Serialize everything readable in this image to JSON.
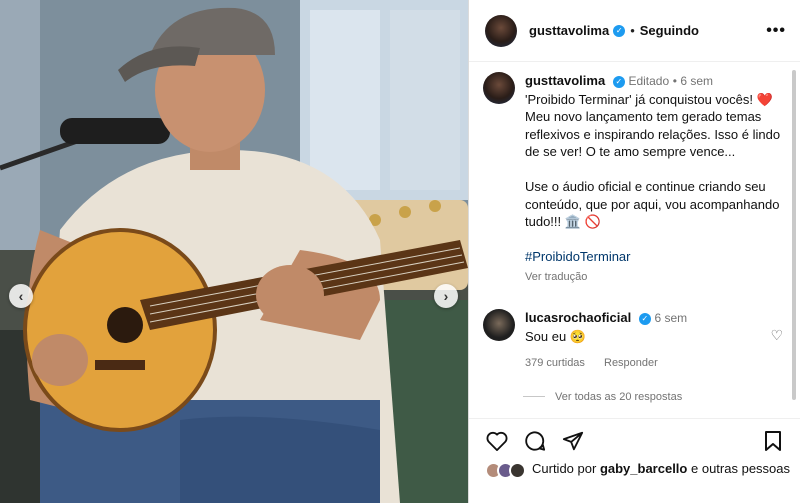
{
  "post": {
    "username": "gusttavolima",
    "follow_status": "Seguindo",
    "more_label": "•••"
  },
  "caption": {
    "username": "gusttavolima",
    "edited": "Editado",
    "time": "6 sem",
    "para1": "'Proibido Terminar' já conquistou vocês! ❤️ Meu novo lançamento tem gerado temas reflexivos e inspirando relações. Isso é lindo de se ver! O te amo sempre vence...",
    "para2": "Use o áudio oficial e continue criando seu conteúdo, que por aqui, vou acompanhando tudo!!! 🏛️ 🚫",
    "hashtag": "#ProibidoTerminar",
    "translate": "Ver tradução"
  },
  "reply": {
    "username": "lucasrochaoficial",
    "time": "6 sem",
    "text": "Sou eu 🥺",
    "likes": "379 curtidas",
    "reply_label": "Responder",
    "view_replies": "Ver todas as 20 respostas"
  },
  "likes": {
    "prefix": "Curtido por",
    "user": "gaby_barcello",
    "suffix": "e outras pessoas"
  },
  "icons": {
    "like": "heart-icon",
    "comment": "comment-icon",
    "share": "share-icon",
    "save": "bookmark-icon"
  },
  "colors": {
    "verified": "#1d9bf0",
    "link": "#00376b",
    "muted": "#737373"
  }
}
